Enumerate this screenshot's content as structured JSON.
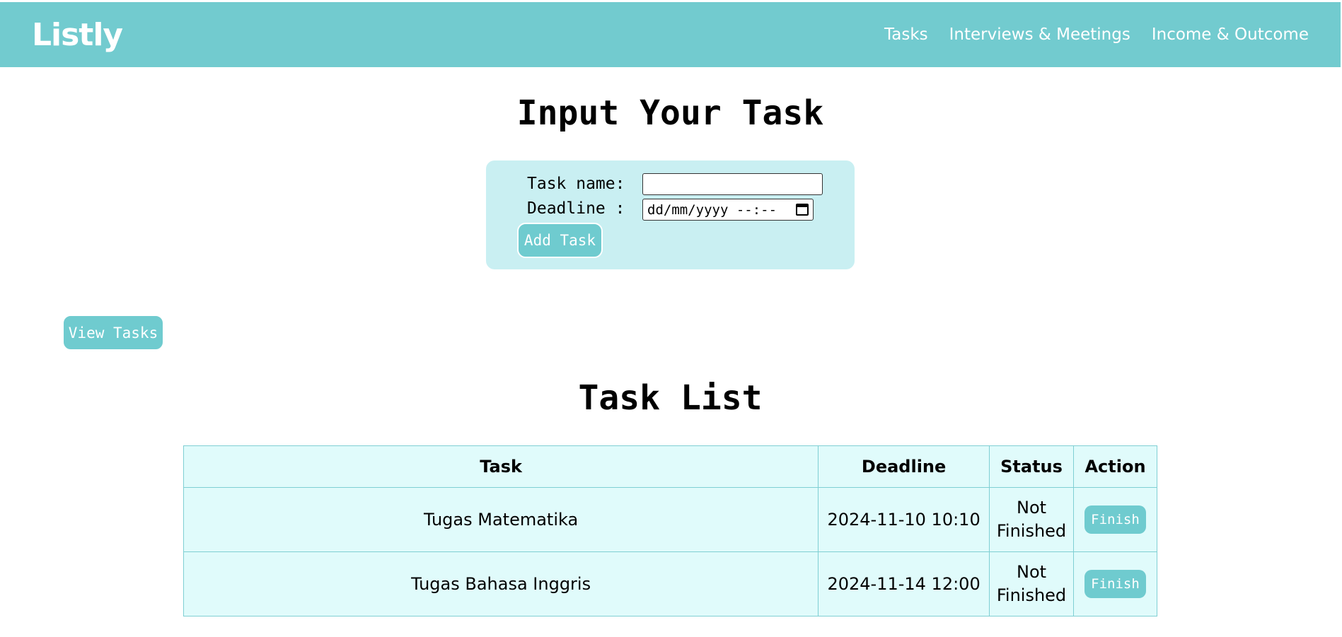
{
  "navbar": {
    "brand": "Listly",
    "links": [
      "Tasks",
      "Interviews & Meetings",
      "Income & Outcome"
    ]
  },
  "form": {
    "title": "Input Your Task",
    "task_name_label": "Task name:",
    "task_name_value": "",
    "deadline_label": "Deadline :",
    "deadline_placeholder": "dd/mm/yyyy --:--",
    "add_button": "Add Task"
  },
  "view_button": "View Tasks",
  "task_list": {
    "title": "Task List",
    "headers": [
      "Task",
      "Deadline",
      "Status",
      "Action"
    ],
    "rows": [
      {
        "task": "Tugas Matematika",
        "deadline": "2024-11-10 10:10",
        "status_line1": "Not",
        "status_line2": "Finished",
        "action": "Finish"
      },
      {
        "task": "Tugas Bahasa Inggris",
        "deadline": "2024-11-14 12:00",
        "status_line1": "Not",
        "status_line2": "Finished",
        "action": "Finish"
      }
    ]
  },
  "colors": {
    "accent": "#72cbcf",
    "form_bg": "#c9eff2",
    "table_bg": "#e0fbfb"
  }
}
